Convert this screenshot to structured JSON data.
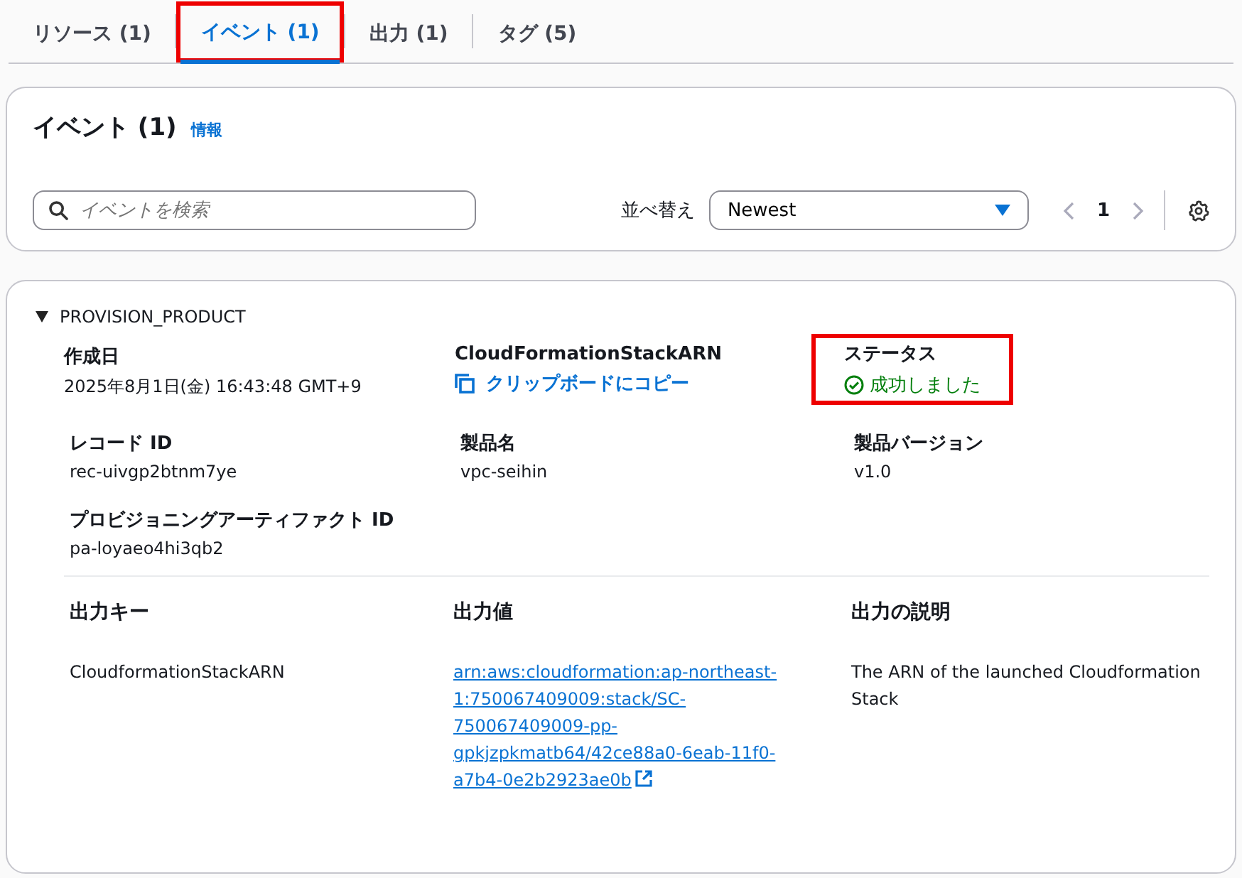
{
  "tabs": [
    {
      "label": "リソース (1)",
      "selected": false,
      "highlighted": false
    },
    {
      "label": "イベント (1)",
      "selected": true,
      "highlighted": true
    },
    {
      "label": "出力 (1)",
      "selected": false,
      "highlighted": false
    },
    {
      "label": "タグ (5)",
      "selected": false,
      "highlighted": false
    }
  ],
  "events_panel": {
    "title": "イベント (1)",
    "info_link": "情報",
    "search": {
      "placeholder": "イベントを検索"
    },
    "sort": {
      "label": "並べ替え",
      "value": "Newest"
    },
    "pagination": {
      "page": "1"
    }
  },
  "event": {
    "name": "PROVISION_PRODUCT",
    "expanded": true,
    "fields": [
      {
        "kind": "text",
        "label": "作成日",
        "value": "2025年8月1日(金) 16:43:48 GMT+9",
        "highlighted": false
      },
      {
        "kind": "copy",
        "label": "CloudFormationStackARN",
        "value": "クリップボードにコピー",
        "highlighted": false
      },
      {
        "kind": "status",
        "label": "ステータス",
        "value": "成功しました",
        "highlighted": true
      },
      {
        "kind": "text",
        "label": "レコード ID",
        "value": "rec-uivgp2btnm7ye",
        "highlighted": false
      },
      {
        "kind": "text",
        "label": "製品名",
        "value": "vpc-seihin",
        "highlighted": false
      },
      {
        "kind": "text",
        "label": "製品バージョン",
        "value": "v1.0",
        "highlighted": false
      },
      {
        "kind": "text",
        "label": "プロビジョニングアーティファクト ID",
        "value": "pa-loyaeo4hi3qb2",
        "highlighted": false
      }
    ],
    "outputs": {
      "columns": [
        "出力キー",
        "出力値",
        "出力の説明"
      ],
      "rows": [
        {
          "key": "CloudformationStackARN",
          "value": "arn:aws:cloudformation:ap-northeast-1:750067409009:stack/SC-750067409009-pp-gpkjzpkmatb64/42ce88a0-6eab-11f0-a7b4-0e2b2923ae0b",
          "description": "The ARN of the launched Cloudformation Stack"
        }
      ]
    }
  }
}
